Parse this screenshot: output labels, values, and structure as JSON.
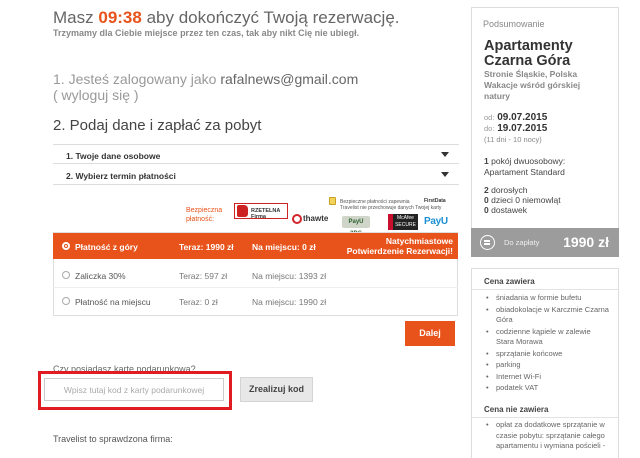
{
  "timer": {
    "prefix": "Masz",
    "time": "09:38",
    "suffix": "aby dokończyć Twoją rezerwację.",
    "subtitle": "Trzymamy dla Ciebie miejsce przez ten czas, tak aby nikt Cię nie ubiegł."
  },
  "step1": {
    "prefix": "1. Jesteś zalogowany jako",
    "email": "rafalnews@gmail.com",
    "logout": "( wyloguj się )"
  },
  "step2": {
    "title": "2. Podaj dane i zapłać za pobyt",
    "sections": [
      "1. Twoje dane osobowe",
      "2. Wybierz termin płatności"
    ]
  },
  "security": {
    "label_line1": "Bezpieczna",
    "label_line2": "płatność:",
    "note_line1": "Bezpieczne płatności zapewnia",
    "note_line2": "Travelist nie przechowuje danych Twojej karty",
    "logos": {
      "rzetelna": "RZETELNA Firma",
      "firstdata": "FirstData",
      "thawte": "thawte",
      "payu_3ds": "PayU 3DS",
      "mcafee_line1": "McAfee",
      "mcafee_line2": "SECURE",
      "payu": "PayU"
    }
  },
  "payment_options": [
    {
      "name": "Płatność z góry",
      "now": "Teraz: 1990 zł",
      "onsite": "Na miejscu: 0 zł",
      "promo_line1": "Natychmiastowe",
      "promo_line2": "Potwierdzenie Rezerwacji!",
      "selected": true
    },
    {
      "name": "Zaliczka 30%",
      "now": "Teraz: 597 zł",
      "onsite": "Na miejscu: 1393 zł",
      "selected": false
    },
    {
      "name": "Płatność na miejscu",
      "now": "Teraz: 0 zł",
      "onsite": "Na miejscu: 1990 zł",
      "selected": false
    }
  ],
  "next_button": "Dalej",
  "gift_card": {
    "question": "Czy posiadasz kartę podarunkową?",
    "placeholder": "Wpisz tutaj kod z karty podarunkowej",
    "value": "",
    "redeem_button": "Zrealizuj kod"
  },
  "trust_text": "Travelist to sprawdzona firma:",
  "summary": {
    "header": "Podsumowanie",
    "title": "Apartamenty Czarna Góra",
    "location_line1": "Stronie Śląskie, Polska",
    "location_line2": "Wakacje wśród górskiej natury",
    "from_label": "od:",
    "from_date": "09.07.2015",
    "to_label": "do:",
    "to_date": "19.07.2015",
    "nights": "(11 dni - 10 nocy)",
    "room_count": "1",
    "room_text": "pokój dwuosobowy:",
    "room_type": "Apartament Standard",
    "adults_count": "2",
    "adults_text": "dorosłych",
    "infants_count": "0",
    "infants_text": "dzieci 0 niemowląt",
    "extra_count": "0",
    "extra_text": "dostawek",
    "to_pay_label": "Do zapłaty",
    "to_pay_amount": "1990 zł"
  },
  "includes": {
    "header": "Cena zawiera",
    "items": [
      "śniadania w formie bufetu",
      "obiadokolacje w Karczmie Czarna Góra",
      "codzienne kąpiele w zalewie Stara Morawa",
      "sprzątanie końcowe",
      "parking",
      "Internet Wi-Fi",
      "podatek VAT"
    ]
  },
  "excludes": {
    "header": "Cena nie zawiera",
    "items": [
      "opłat za dodatkowe sprzątanie w czasie pobytu: sprzątanie całego apartamentu i wymiana pościeli -"
    ]
  },
  "colors": {
    "accent": "#e8531b",
    "highlight_frame": "#e11b22",
    "summary_bar": "#9c9c9c"
  }
}
